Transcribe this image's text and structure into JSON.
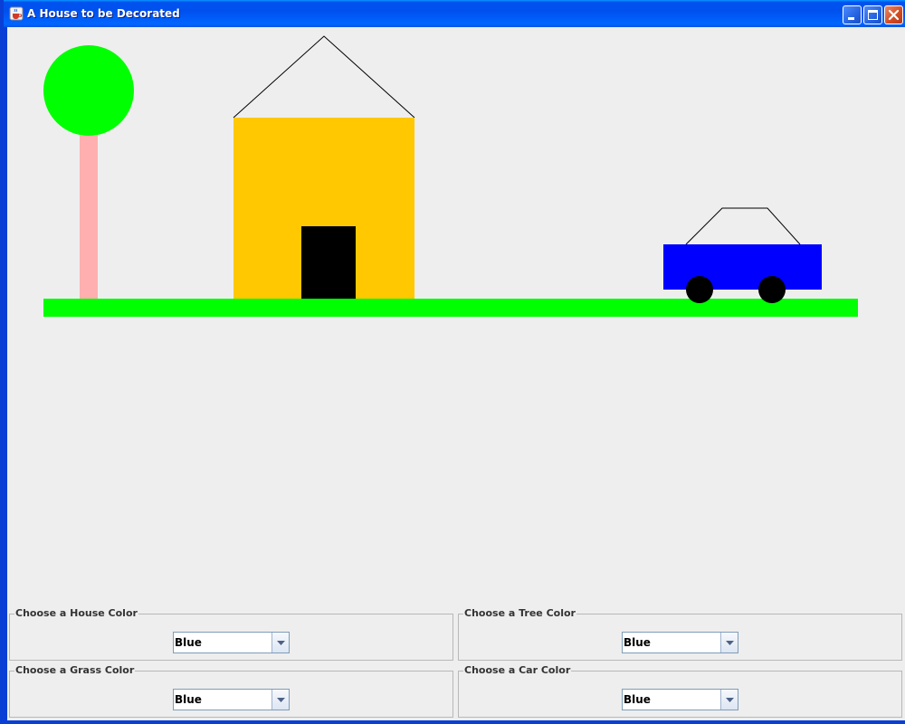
{
  "window": {
    "title": "A House to be Decorated",
    "icon": "java-cup-icon"
  },
  "titlebar_buttons": [
    "minimize-icon",
    "maximize-icon",
    "close-icon"
  ],
  "scene": {
    "colors": {
      "tree_canopy": "#00ff00",
      "tree_trunk": "#ffafaf",
      "house_body": "#ffc800",
      "door": "#000000",
      "roof_line": "#000000",
      "grass": "#00ff00",
      "car_body": "#0000ff",
      "car_wheels": "#000000",
      "car_cabin_line": "#000000"
    }
  },
  "panels": [
    {
      "title": "Choose a House Color",
      "selected": "Blue"
    },
    {
      "title": "Choose a Tree Color",
      "selected": "Blue"
    },
    {
      "title": "Choose a Grass Color",
      "selected": "Blue"
    },
    {
      "title": "Choose a Car Color",
      "selected": "Blue"
    }
  ]
}
